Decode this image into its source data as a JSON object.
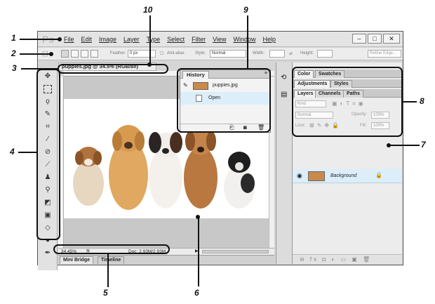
{
  "app": {
    "logo": "Ps"
  },
  "menu": [
    "File",
    "Edit",
    "Image",
    "Layer",
    "Type",
    "Select",
    "Filter",
    "View",
    "Window",
    "Help"
  ],
  "window_buttons": [
    "–",
    "□",
    "✕"
  ],
  "options_bar": {
    "feather_label": "Feather:",
    "feather_value": "0 px",
    "antialias_label": "Anti-alias",
    "style_label": "Style:",
    "style_value": "Normal",
    "width_label": "Width:",
    "height_label": "Height:",
    "refine_edge": "Refine Edge..."
  },
  "document": {
    "tab_title": "puppies.jpg @ 34.5% (RGB/8#)",
    "zoom": "34.45%",
    "doc_info": "Doc: 2.93M/2.93M"
  },
  "bottom_tabs": [
    "Mini Bridge",
    "Timeline"
  ],
  "history": {
    "tab": "History",
    "snapshot": "puppies.jpg",
    "step": "Open"
  },
  "panels": {
    "row1": [
      "Color",
      "Swatches"
    ],
    "row2": [
      "Adjustments",
      "Styles"
    ],
    "row3": [
      "Layers",
      "Channels",
      "Paths"
    ],
    "kind": "Kind",
    "blend": "Normal",
    "opacity_label": "Opacity:",
    "opacity": "100%",
    "lock_label": "Lock:",
    "fill_label": "Fill:",
    "fill": "100%",
    "layer_name": "Background",
    "footer_icons": "⊖  fx  ◘  ◐  ▭  ▣  🗑"
  },
  "callouts": [
    "1",
    "2",
    "3",
    "4",
    "5",
    "6",
    "7",
    "8",
    "9",
    "10"
  ],
  "colors": {
    "layer_highlight": "#dbeefa",
    "window_bg": "#d6d6d6",
    "callout": "#111111"
  }
}
